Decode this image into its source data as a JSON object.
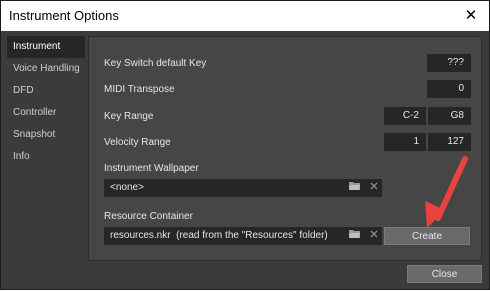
{
  "window": {
    "title": "Instrument Options",
    "close_glyph": "✕"
  },
  "sidebar": {
    "items": [
      {
        "label": "Instrument",
        "active": true
      },
      {
        "label": "Voice Handling"
      },
      {
        "label": "DFD"
      },
      {
        "label": "Controller"
      },
      {
        "label": "Snapshot"
      },
      {
        "label": "Info"
      }
    ]
  },
  "instrument": {
    "key_switch": {
      "label": "Key Switch default Key",
      "value": "???"
    },
    "midi_transpose": {
      "label": "MIDI Transpose",
      "value": "0"
    },
    "key_range": {
      "label": "Key Range",
      "low": "C-2",
      "high": "G8"
    },
    "velocity_range": {
      "label": "Velocity Range",
      "low": "1",
      "high": "127"
    },
    "wallpaper": {
      "label": "Instrument Wallpaper",
      "value": "<none>"
    },
    "resource_container": {
      "label": "Resource Container",
      "value": "resources.nkr  (read from the \"Resources\" folder)",
      "create_label": "Create"
    }
  },
  "footer": {
    "close_label": "Close"
  },
  "icons": {
    "folder": "folder-icon",
    "clear": "clear-icon",
    "annotation": "red-arrow"
  },
  "colors": {
    "panel": "#464646",
    "field": "#262626",
    "annotation": "#e8433f"
  }
}
